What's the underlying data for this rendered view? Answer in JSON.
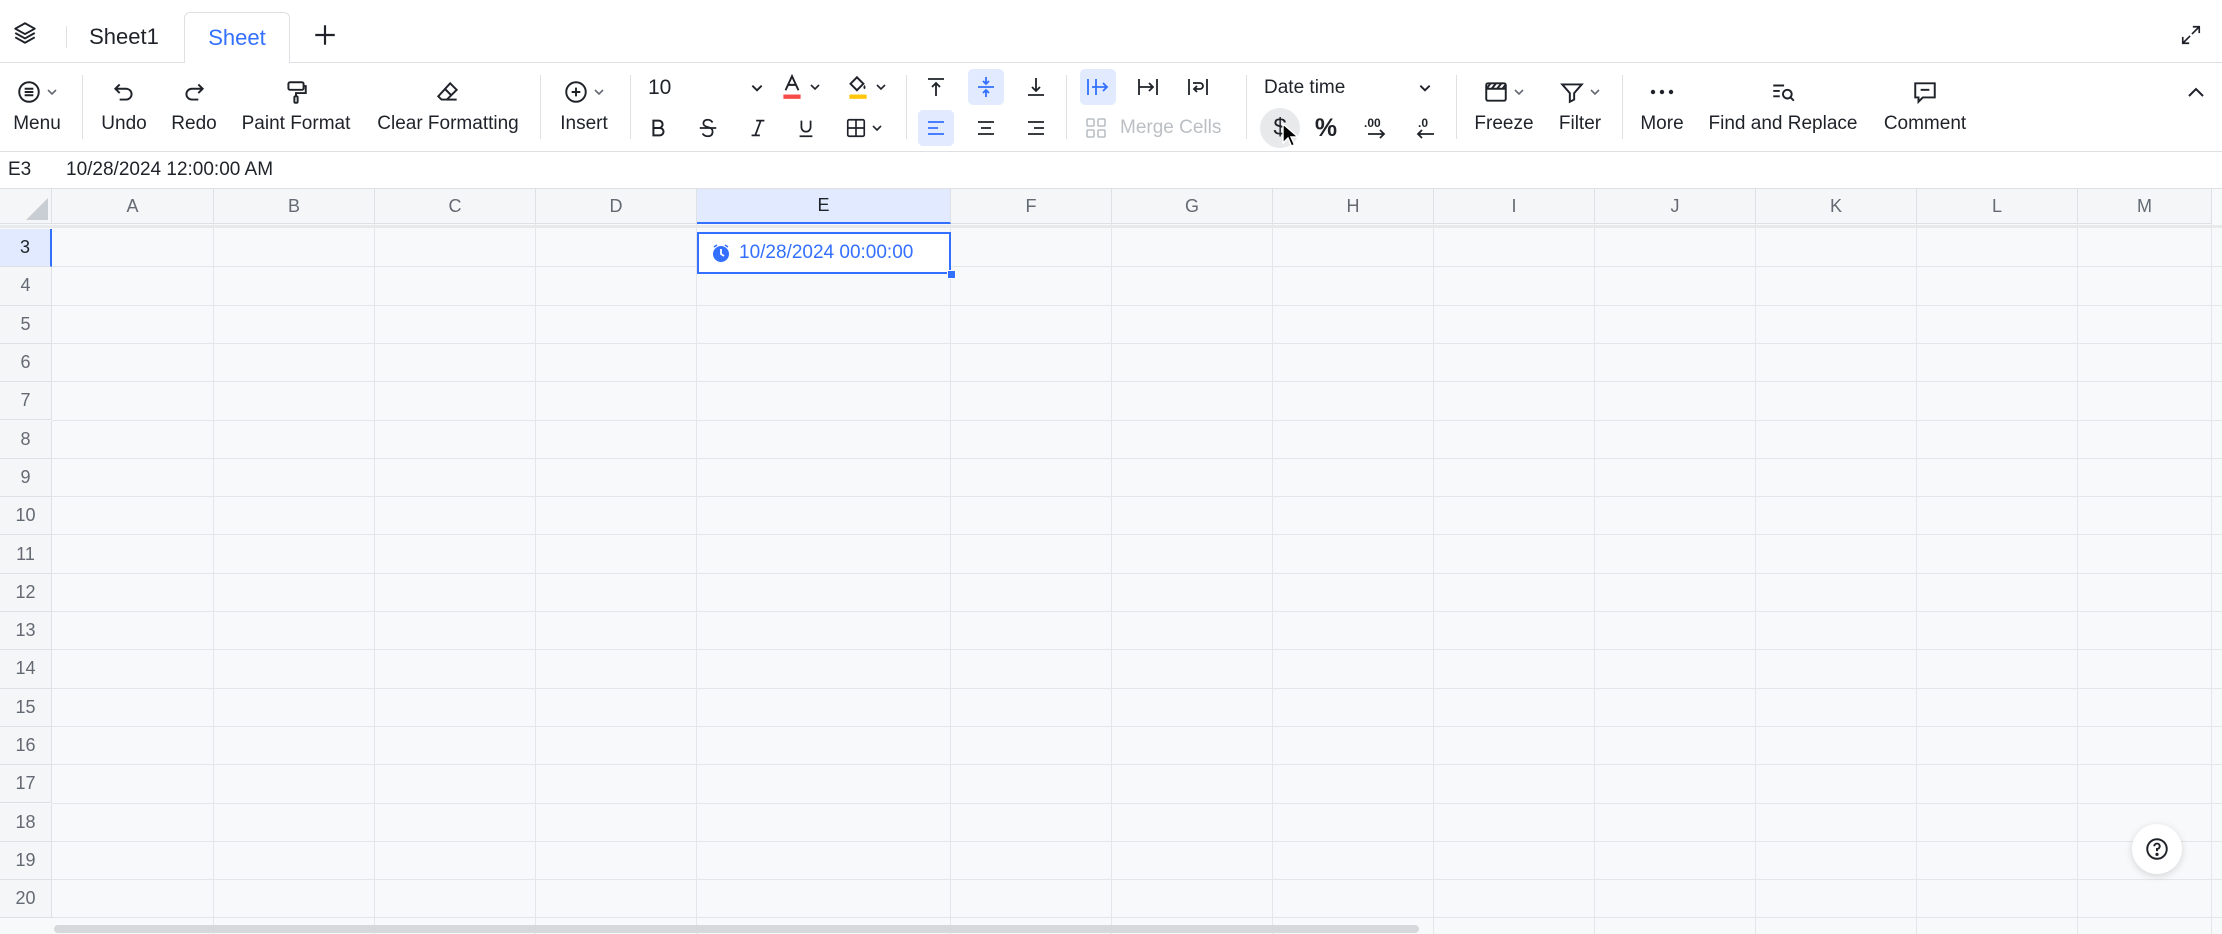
{
  "tabs": [
    {
      "label": "Sheet1",
      "active": false
    },
    {
      "label": "Sheet",
      "active": true
    }
  ],
  "toolbar": {
    "menu": "Menu",
    "undo": "Undo",
    "redo": "Redo",
    "paint_format": "Paint Format",
    "clear_formatting": "Clear Formatting",
    "insert": "Insert",
    "font_size": "10",
    "merge_cells": "Merge Cells",
    "number_format": "Date time",
    "percent": "%",
    "freeze": "Freeze",
    "filter": "Filter",
    "more": "More",
    "find_replace": "Find and Replace",
    "comment": "Comment"
  },
  "formula_bar": {
    "cell_ref": "E3",
    "value": "10/28/2024 12:00:00 AM"
  },
  "columns": [
    "A",
    "B",
    "C",
    "D",
    "E",
    "F",
    "G",
    "H",
    "I",
    "J",
    "K",
    "L",
    "M"
  ],
  "rows": [
    "3",
    "4",
    "5",
    "6",
    "7",
    "8",
    "9",
    "10",
    "11",
    "12",
    "13",
    "14",
    "15",
    "16",
    "17",
    "18",
    "19",
    "20"
  ],
  "selected_cell": {
    "column": "E",
    "row": "3",
    "display": "10/28/2024 00:00:00"
  },
  "colors": {
    "accent": "#3370ff",
    "font_color_bar": "#f54a45",
    "fill_color_bar": "#ffc60a"
  }
}
